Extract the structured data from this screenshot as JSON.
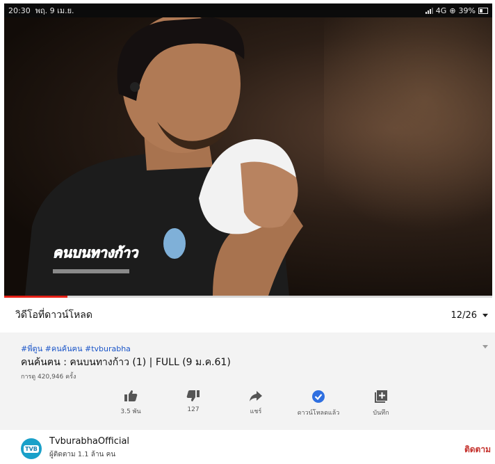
{
  "status_bar": {
    "time": "20:30",
    "date": "พฤ. 9 เม.ย.",
    "network": "4G",
    "battery": "39%"
  },
  "player": {
    "played_fraction": 0.13,
    "overlay_logo_text": "คนบนทางก้าว"
  },
  "download_section": {
    "title": "วิดีโอที่ดาวน์โหลด",
    "count": "12/26"
  },
  "video": {
    "hashtags": "#พี่ตูน #คนค้นฅน #tvburabha",
    "title": "คนค้นฅน : คนบนทางก้าว (1) | FULL (9 ม.ค.61)",
    "views": "การดู 420,946 ครั้ง"
  },
  "actions": {
    "like_label": "3.5 พัน",
    "dislike_label": "127",
    "share_label": "แชร์",
    "downloaded_label": "ดาวน์โหลดแล้ว",
    "save_label": "บันทึก"
  },
  "channel": {
    "avatar_text": "TVB",
    "name": "TvburabhaOfficial",
    "subscribers": "ผู้ติดตาม 1.1 ล้าน คน",
    "subscribe_label": "ติดตาม"
  },
  "colors": {
    "progress": "#e62117",
    "hashtags": "#1a55c8",
    "subscribe": "#c4302b",
    "downloaded_icon": "#2f6fe0"
  }
}
